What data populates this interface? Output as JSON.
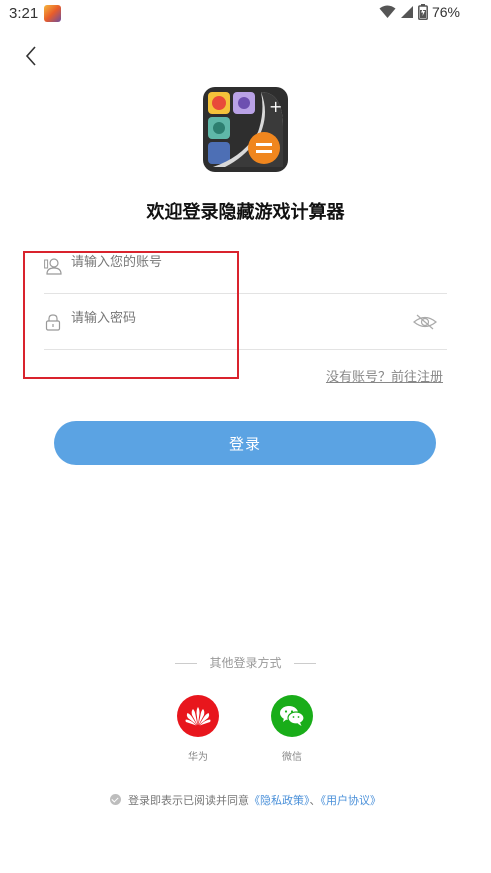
{
  "status_bar": {
    "time": "3:21",
    "battery_percent": "76%"
  },
  "header": {
    "back_icon": "chevron-left-icon"
  },
  "app": {
    "title": "欢迎登录隐藏游戏计算器"
  },
  "form": {
    "account_placeholder": "请输入您的账号",
    "account_value": "",
    "password_placeholder": "请输入密码",
    "password_value": "",
    "register_link": "没有账号？前往注册",
    "login_button": "登录"
  },
  "other_login": {
    "heading": "其他登录方式",
    "providers": [
      {
        "label": "华为",
        "icon": "huawei-icon",
        "color": "#e8161d"
      },
      {
        "label": "微信",
        "icon": "wechat-icon",
        "color": "#19ad19"
      }
    ]
  },
  "agreement": {
    "prefix": "登录即表示已阅读并同意",
    "privacy": "《隐私政策》",
    "separator": "、",
    "terms": "《用户协议》"
  },
  "colors": {
    "accent": "#5ba3e3",
    "highlight": "#d9232d",
    "link": "#4a90d9"
  }
}
